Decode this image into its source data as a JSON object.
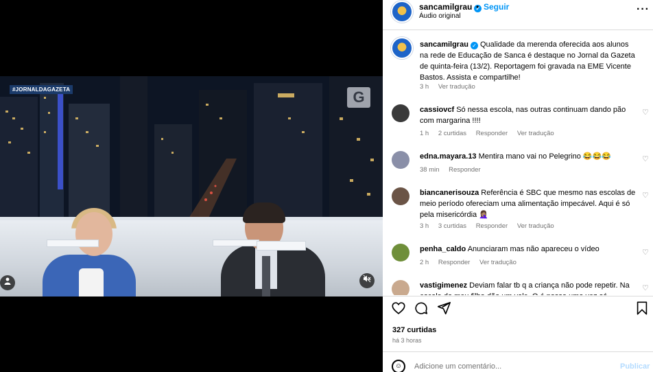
{
  "video": {
    "news_tag": "#JORNALDAGAZETA",
    "channel_logo": "G",
    "icons": {
      "profile": "person-icon",
      "mute": "muted-speaker-icon"
    }
  },
  "header": {
    "username": "sancamilgrau",
    "separator": "•",
    "follow_label": "Seguir",
    "audio_label": "Áudio original",
    "more_label": "···"
  },
  "caption": {
    "username": "sancamilgrau",
    "text": "Qualidade da merenda oferecida aos alunos na rede de Educação de Sanca é destaque no Jornal da Gazeta de quinta-feira (13/2). Reportagem foi gravada na EME Vicente Bastos. Assista e compartilhe!",
    "time": "3 h",
    "translate": "Ver tradução"
  },
  "comments": [
    {
      "username": "cassiovcf",
      "text": "Só nessa escola, nas outras continuam dando pão com margarina !!!!",
      "time": "1 h",
      "likes": "2 curtidas",
      "reply": "Responder",
      "translate": "Ver tradução",
      "avatar_color": "#3a3a3a"
    },
    {
      "username": "edna.mayara.13",
      "text": "Mentira mano vai no Pelegrino 😂😂😂",
      "time": "38 min",
      "likes": "",
      "reply": "Responder",
      "translate": "",
      "avatar_color": "#8a8fa8"
    },
    {
      "username": "biancanerisouza",
      "text": "Referência é SBC que mesmo nas escolas de meio período ofereciam uma alimentação impecável. Aqui é só pela misericórdia 🤦🏽‍♀️",
      "time": "3 h",
      "likes": "3 curtidas",
      "reply": "Responder",
      "translate": "Ver tradução",
      "avatar_color": "#6b5446"
    },
    {
      "username": "penha_caldo",
      "text": "Anunciaram mas não apareceu o vídeo",
      "time": "2 h",
      "likes": "",
      "reply": "Responder",
      "translate": "Ver tradução",
      "avatar_color": "#6f8f3a"
    },
    {
      "username": "vastigimenez",
      "text": "Deviam falar tb q a criança não pode repetir. Na escola do meu filho dão um vale. O é nosso uma vez só",
      "time": "",
      "likes": "",
      "reply": "",
      "translate": "",
      "avatar_color": "#c9a98e"
    }
  ],
  "actions": {
    "icons": [
      "heart-icon",
      "comment-icon",
      "share-icon",
      "bookmark-icon"
    ]
  },
  "stats": {
    "likes": "327 curtidas",
    "posted": "há 3 horas"
  },
  "add_comment": {
    "placeholder": "Adicione um comentário...",
    "publish_label": "Publicar"
  },
  "colors": {
    "link_blue": "#0095f6",
    "muted_text": "#737373",
    "publish_disabled": "#b3dbff"
  }
}
